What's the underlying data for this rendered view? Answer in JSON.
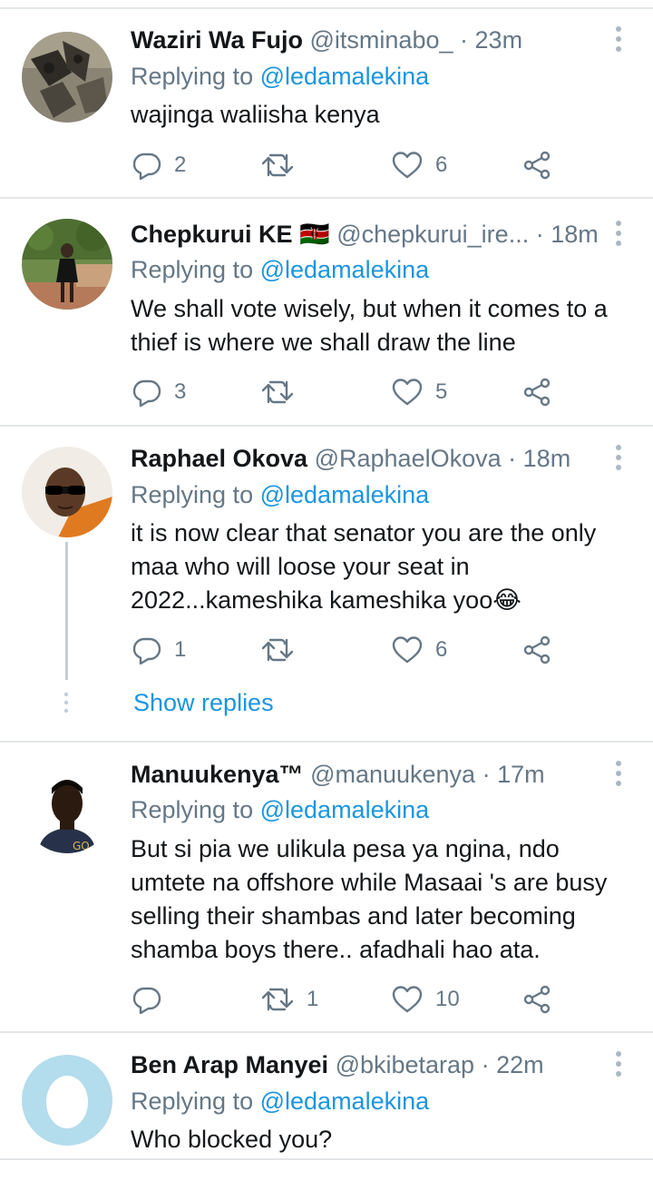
{
  "tweets": [
    {
      "name": "Waziri Wa Fujo",
      "flag": "",
      "handle": "@itsminabo_",
      "separator": "·",
      "time": "23m",
      "replying_prefix": "Replying to",
      "replying_to": "@ledamalekina",
      "text": "wajinga waliisha kenya",
      "replies": "2",
      "retweets": "",
      "likes": "6"
    },
    {
      "name": "Chepkurui KE",
      "flag": "🇰🇪",
      "handle": "@chepkurui_ire...",
      "separator": "·",
      "time": "18m",
      "replying_prefix": "Replying to",
      "replying_to": "@ledamalekina",
      "text": "We shall vote wisely, but when it comes to a thief is where we shall draw the line",
      "replies": "3",
      "retweets": "",
      "likes": "5"
    },
    {
      "name": "Raphael Okova",
      "flag": "",
      "handle": "@RaphaelOkova",
      "separator": "·",
      "time": "18m",
      "replying_prefix": "Replying to",
      "replying_to": "@ledamalekina",
      "text": "it is now clear that senator you are the only maa who will loose your seat in 2022...kameshika kameshika yoo😂",
      "replies": "1",
      "retweets": "",
      "likes": "6",
      "show_replies": "Show replies"
    },
    {
      "name": "Manuukenya™",
      "flag": "",
      "handle": "@manuukenya",
      "separator": "·",
      "time": "17m",
      "replying_prefix": "Replying to",
      "replying_to": "@ledamalekina",
      "text": "But si pia we ulikula pesa ya ngina, ndo umtete na offshore while Masaai 's are busy selling their shambas and later becoming shamba boys there.. afadhali hao ata.",
      "replies": "",
      "retweets": "1",
      "likes": "10"
    },
    {
      "name": "Ben Arap Manyei",
      "flag": "",
      "handle": "@bkibetarap",
      "separator": "·",
      "time": "22m",
      "replying_prefix": "Replying to",
      "replying_to": "@ledamalekina",
      "text": "Who blocked you?"
    }
  ],
  "icons": {
    "reply": "reply-icon",
    "retweet": "retweet-icon",
    "like": "heart-icon",
    "share": "share-icon",
    "more": "more-vertical-icon"
  },
  "colors": {
    "link": "#1b95e0",
    "secondary_text": "#657786",
    "primary_text": "#14171a",
    "divider": "#e3e6e8"
  }
}
